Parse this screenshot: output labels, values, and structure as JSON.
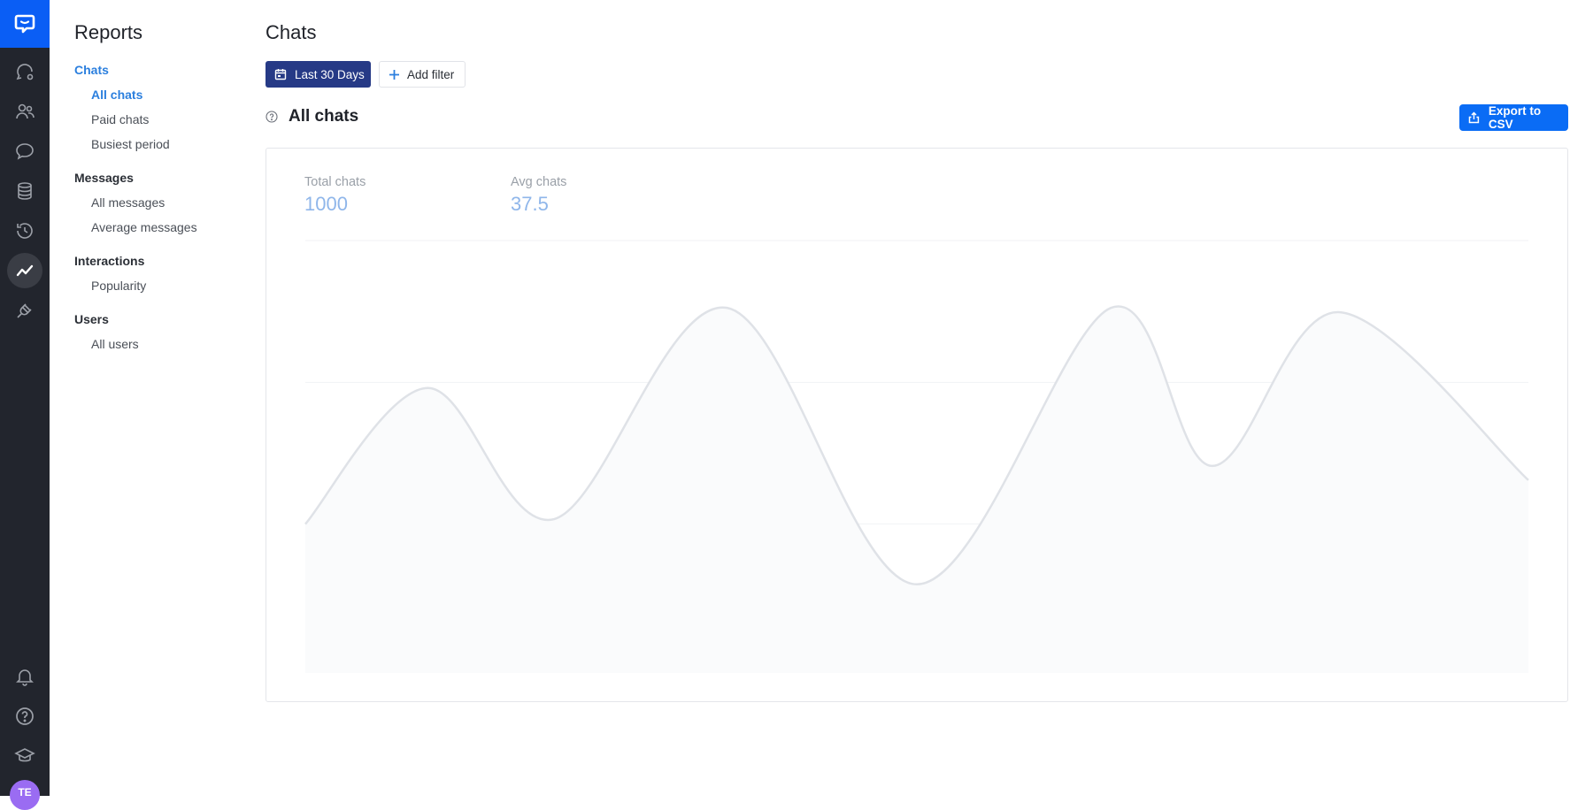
{
  "rail": {
    "logo": "chat-bubble-logo",
    "items": [
      {
        "name": "chats",
        "icon": "chat-dots-icon"
      },
      {
        "name": "customers",
        "icon": "users-icon"
      },
      {
        "name": "archives",
        "icon": "speech-bubble-icon"
      },
      {
        "name": "data",
        "icon": "database-icon"
      },
      {
        "name": "history",
        "icon": "history-icon"
      },
      {
        "name": "reports",
        "icon": "reports-chart-icon",
        "active": true
      },
      {
        "name": "integrations",
        "icon": "plug-icon"
      }
    ],
    "bottom": [
      {
        "name": "notifications",
        "icon": "bell-icon"
      },
      {
        "name": "help",
        "icon": "question-icon"
      },
      {
        "name": "academy",
        "icon": "graduation-cap-icon"
      }
    ],
    "avatar_initials": "TE",
    "avatar_color": "#9a6cf2"
  },
  "subnav": {
    "title": "Reports",
    "groups": [
      {
        "label": "Chats",
        "active": true,
        "items": [
          {
            "label": "All chats",
            "active": true
          },
          {
            "label": "Paid chats"
          },
          {
            "label": "Busiest period"
          }
        ]
      },
      {
        "label": "Messages",
        "items": [
          {
            "label": "All messages"
          },
          {
            "label": "Average messages"
          }
        ]
      },
      {
        "label": "Interactions",
        "items": [
          {
            "label": "Popularity"
          }
        ]
      },
      {
        "label": "Users",
        "items": [
          {
            "label": "All users"
          }
        ]
      }
    ]
  },
  "main": {
    "title": "Chats",
    "date_filter": "Last 30 Days",
    "add_filter": "Add filter",
    "section_title": "All chats",
    "export_label": "Export to CSV",
    "stats": [
      {
        "label": "Total chats",
        "value": "1000"
      },
      {
        "label": "Avg chats",
        "value": "37.5"
      }
    ]
  },
  "colors": {
    "accent": "#0a6cf5",
    "date_button": "#263a86",
    "active_link": "#2b7fde",
    "rail_bg": "#22252d",
    "line": "#dfe2e7",
    "area": "#fafbfc",
    "grid": "#f1f2f4"
  },
  "chart_data": {
    "type": "area",
    "title": "All chats",
    "xlabel": "",
    "ylabel": "",
    "x": [
      0,
      2.9,
      5.9,
      10.0,
      14.5,
      19.1,
      21.5,
      24.5,
      29
    ],
    "values": [
      20,
      39.2,
      20.7,
      50.5,
      11.5,
      50.5,
      28.2,
      49.9,
      26.2
    ],
    "xlim": [
      0,
      29
    ],
    "ylim": [
      0,
      60
    ],
    "gridlines": [
      20,
      40,
      60
    ],
    "grid": true,
    "legend": "none"
  }
}
